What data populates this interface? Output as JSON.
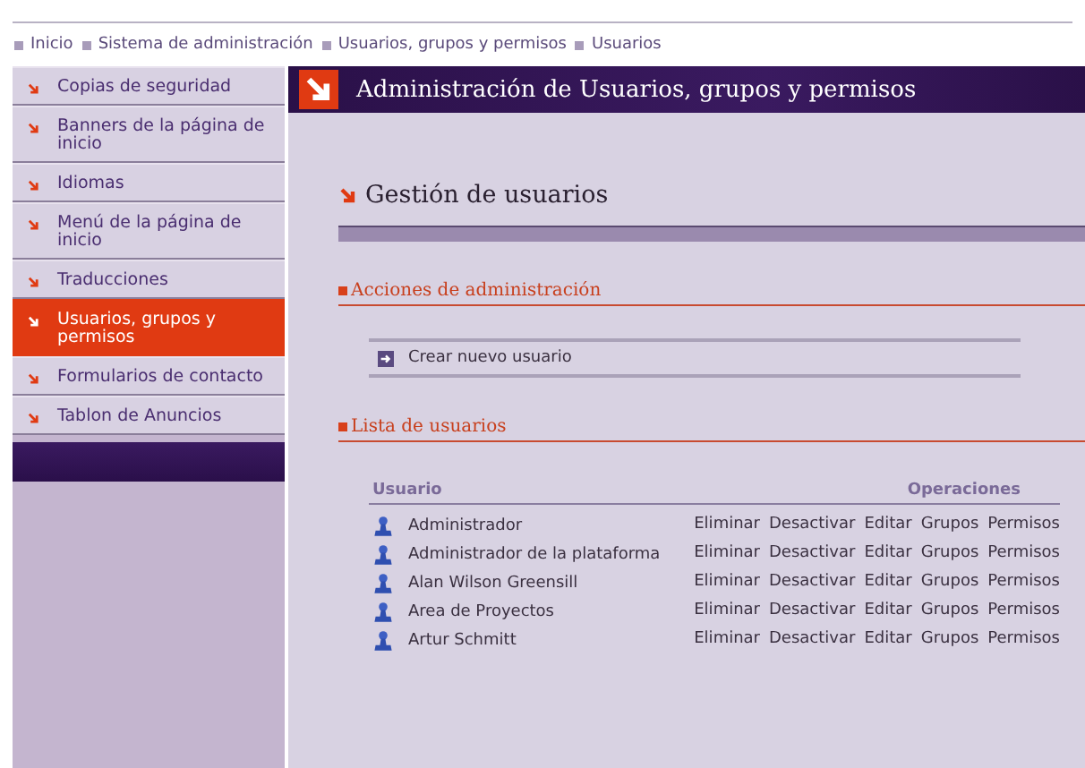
{
  "breadcrumb": [
    "Inicio",
    "Sistema de administración",
    "Usuarios, grupos y permisos",
    "Usuarios"
  ],
  "sidebar": {
    "items": [
      {
        "label": "Copias de seguridad",
        "selected": false
      },
      {
        "label": "Banners de la página de inicio",
        "selected": false
      },
      {
        "label": "Idiomas",
        "selected": false
      },
      {
        "label": "Menú de la página de inicio",
        "selected": false
      },
      {
        "label": "Traducciones",
        "selected": false
      },
      {
        "label": "Usuarios, grupos y permisos",
        "selected": true
      },
      {
        "label": "Formularios de contacto",
        "selected": false
      },
      {
        "label": "Tablon de Anuncios",
        "selected": false
      }
    ]
  },
  "header": {
    "title": "Administración de Usuarios, grupos y permisos"
  },
  "page_title": "Gestión de usuarios",
  "actions": {
    "title": "Acciones de administración",
    "items": [
      "Crear nuevo usuario"
    ]
  },
  "users": {
    "title": "Lista de usuarios",
    "columns": [
      "Usuario",
      "Operaciones"
    ],
    "rows": [
      {
        "name": "Administrador",
        "operations": [
          "Eliminar",
          "Desactivar",
          "Editar",
          "Grupos",
          "Permisos"
        ]
      },
      {
        "name": "Administrador de la plataforma",
        "operations": [
          "Eliminar",
          "Desactivar",
          "Editar",
          "Grupos",
          "Permisos"
        ]
      },
      {
        "name": "Alan Wilson Greensill",
        "operations": [
          "Eliminar",
          "Desactivar",
          "Editar",
          "Grupos",
          "Permisos"
        ]
      },
      {
        "name": "Area de Proyectos",
        "operations": [
          "Eliminar",
          "Desactivar",
          "Editar",
          "Grupos",
          "Permisos"
        ]
      },
      {
        "name": "Artur Schmitt",
        "operations": [
          "Eliminar",
          "Desactivar",
          "Editar",
          "Grupos",
          "Permisos"
        ]
      }
    ]
  }
}
